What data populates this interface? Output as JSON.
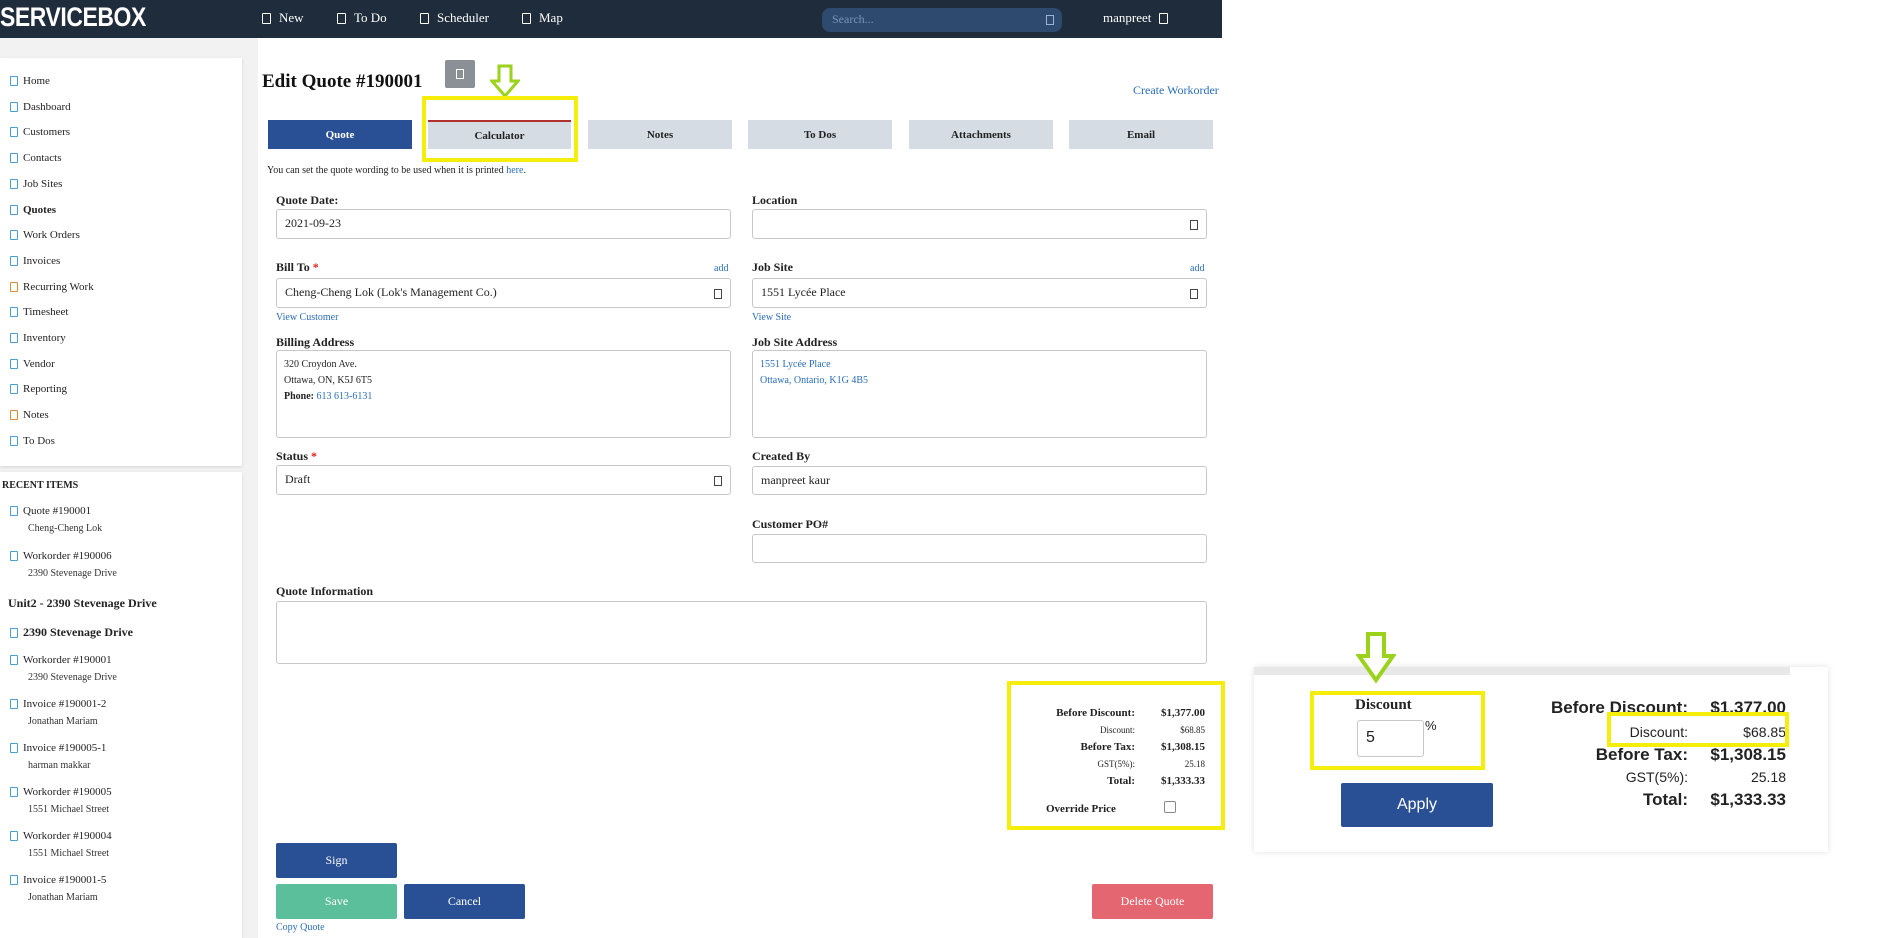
{
  "topbar": {
    "brand": "SERVICEBOX",
    "nav": [
      {
        "label": "New",
        "icon": "plus-icon"
      },
      {
        "label": "To Do",
        "icon": "checklist-icon"
      },
      {
        "label": "Scheduler",
        "icon": "calendar-icon"
      },
      {
        "label": "Map",
        "icon": "map-icon"
      }
    ],
    "search_placeholder": "Search...",
    "user": "manpreet"
  },
  "sidebar": {
    "items": [
      {
        "label": "Home",
        "bold": false
      },
      {
        "label": "Dashboard",
        "bold": false
      },
      {
        "label": "Customers",
        "bold": false
      },
      {
        "label": "Contacts",
        "bold": false
      },
      {
        "label": "Job Sites",
        "bold": false
      },
      {
        "label": "Quotes",
        "bold": true
      },
      {
        "label": "Work Orders",
        "bold": false
      },
      {
        "label": "Invoices",
        "bold": false
      },
      {
        "label": "Recurring Work",
        "bold": false
      },
      {
        "label": "Timesheet",
        "bold": false
      },
      {
        "label": "Inventory",
        "bold": false
      },
      {
        "label": "Vendor",
        "bold": false
      },
      {
        "label": "Reporting",
        "bold": false
      },
      {
        "label": "Notes",
        "bold": false
      },
      {
        "label": "To Dos",
        "bold": false
      }
    ],
    "recent_heading": "RECENT ITEMS",
    "recent": [
      {
        "title": "Quote #190001",
        "sub": "Cheng-Cheng Lok"
      },
      {
        "title": "Workorder #190006",
        "sub": "2390 Stevenage Drive"
      },
      {
        "title": "Unit2 - 2390 Stevenage Drive",
        "sub": ""
      },
      {
        "title": "2390 Stevenage Drive",
        "sub": ""
      },
      {
        "title": "Workorder #190001",
        "sub": "2390 Stevenage Drive"
      },
      {
        "title": "Invoice #190001-2",
        "sub": "Jonathan Mariam"
      },
      {
        "title": "Invoice #190005-1",
        "sub": "harman makkar"
      },
      {
        "title": "Workorder #190005",
        "sub": "1551 Michael Street"
      },
      {
        "title": "Workorder #190004",
        "sub": "1551 Michael Street"
      },
      {
        "title": "Invoice #190001-5",
        "sub": "Jonathan Mariam"
      }
    ]
  },
  "page": {
    "title": "Edit Quote #190001",
    "create_workorder": "Create Workorder",
    "tabs": [
      "Quote",
      "Calculator",
      "Notes",
      "To Dos",
      "Attachments",
      "Email"
    ],
    "note_prefix": "You can set the quote wording to be used when it is printed ",
    "note_link": "here",
    "note_suffix": "."
  },
  "form": {
    "quote_date_label": "Quote Date:",
    "quote_date_value": "2021-09-23",
    "location_label": "Location",
    "location_value": "",
    "bill_to_label": "Bill To",
    "required_mark": "*",
    "add_link": "add",
    "bill_to_value": "Cheng-Cheng Lok (Lok's Management Co.)",
    "view_customer": "View Customer",
    "job_site_label": "Job Site",
    "job_site_value": "1551 Lycée Place",
    "view_site": "View Site",
    "billing_address_label": "Billing Address",
    "billing_address": [
      "320 Croydon Ave.",
      "Ottawa, ON, K5J 6T5"
    ],
    "phone_label": "Phone:",
    "phone_value": "613 613-6131",
    "job_site_address_label": "Job Site Address",
    "job_site_address": [
      "1551 Lycée Place",
      "Ottawa, Ontario, K1G 4B5"
    ],
    "status_label": "Status",
    "status_value": "Draft",
    "created_by_label": "Created By",
    "created_by_value": "manpreet kaur",
    "customer_po_label": "Customer PO#",
    "customer_po_value": "",
    "quote_info_label": "Quote Information",
    "quote_info_value": ""
  },
  "totals": {
    "before_discount_label": "Before Discount:",
    "before_discount": "$1,377.00",
    "discount_label": "Discount:",
    "discount": "$68.85",
    "before_tax_label": "Before Tax:",
    "before_tax": "$1,308.15",
    "gst_label": "GST(5%):",
    "gst": "25.18",
    "total_label": "Total:",
    "total": "$1,333.33",
    "override_label": "Override Price",
    "override_checked": false
  },
  "buttons": {
    "sign": "Sign",
    "save": "Save",
    "cancel": "Cancel",
    "delete": "Delete Quote",
    "copy": "Copy Quote"
  },
  "zoom": {
    "discount_label": "Discount",
    "discount_value": "5",
    "percent": "%",
    "apply": "Apply",
    "before_discount_label": "Before Discount:",
    "before_discount": "$1,377.00",
    "discount_label2": "Discount:",
    "discount": "$68.85",
    "before_tax_label": "Before Tax:",
    "before_tax": "$1,308.15",
    "gst_label": "GST(5%):",
    "gst": "25.18",
    "total_label": "Total:",
    "total": "$1,333.33"
  },
  "colors": {
    "topbar": "#1f2c3b",
    "primary": "#294f94",
    "save": "#5bbf9c",
    "delete": "#e36670",
    "highlight": "#f5ee0a",
    "arrow": "#9bd21c",
    "link": "#2a6db8"
  }
}
